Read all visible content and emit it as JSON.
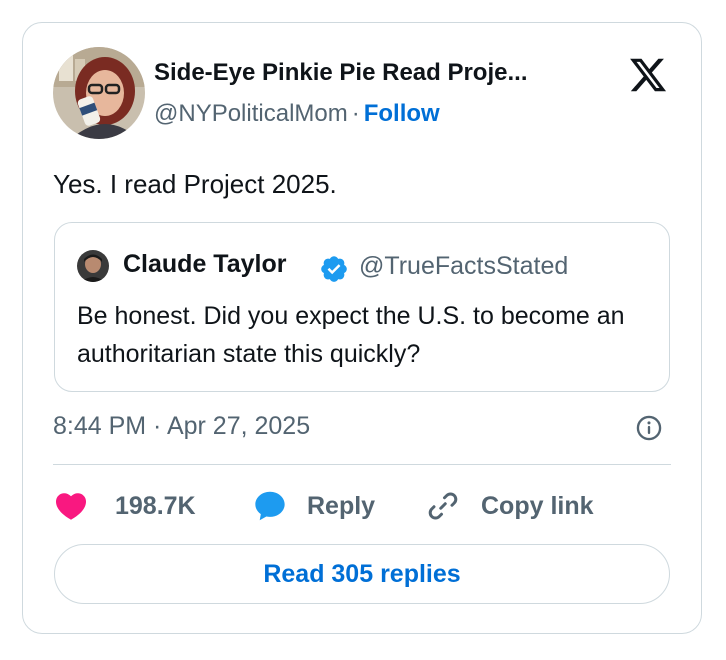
{
  "author": {
    "display_name": "Side-Eye Pinkie Pie Read Proje...",
    "handle": "@NYPoliticalMom",
    "separator": "·",
    "follow_label": "Follow"
  },
  "tweet": {
    "text": "Yes. I read Project 2025.",
    "timestamp": "8:44 PM · Apr 27, 2025"
  },
  "quoted_tweet": {
    "display_name": "Claude Taylor",
    "verified": true,
    "handle": "@TrueFactsStated",
    "text": "Be honest. Did you expect the U.S. to become an authoritarian state this quickly?"
  },
  "actions": {
    "like_count": "198.7K",
    "reply_label": "Reply",
    "copy_link_label": "Copy link"
  },
  "read_replies_label": "Read 305 replies",
  "icons": {
    "platform_logo": "x-logo-icon",
    "info": "info-icon",
    "like": "heart-icon",
    "reply": "speech-bubble-icon",
    "copy": "link-icon",
    "verified": "verified-badge-icon"
  },
  "colors": {
    "like": "#f91880",
    "reply": "#1d9bf0",
    "link_accent": "#006fd6",
    "secondary_text": "#536471",
    "border": "#cfd9de"
  }
}
